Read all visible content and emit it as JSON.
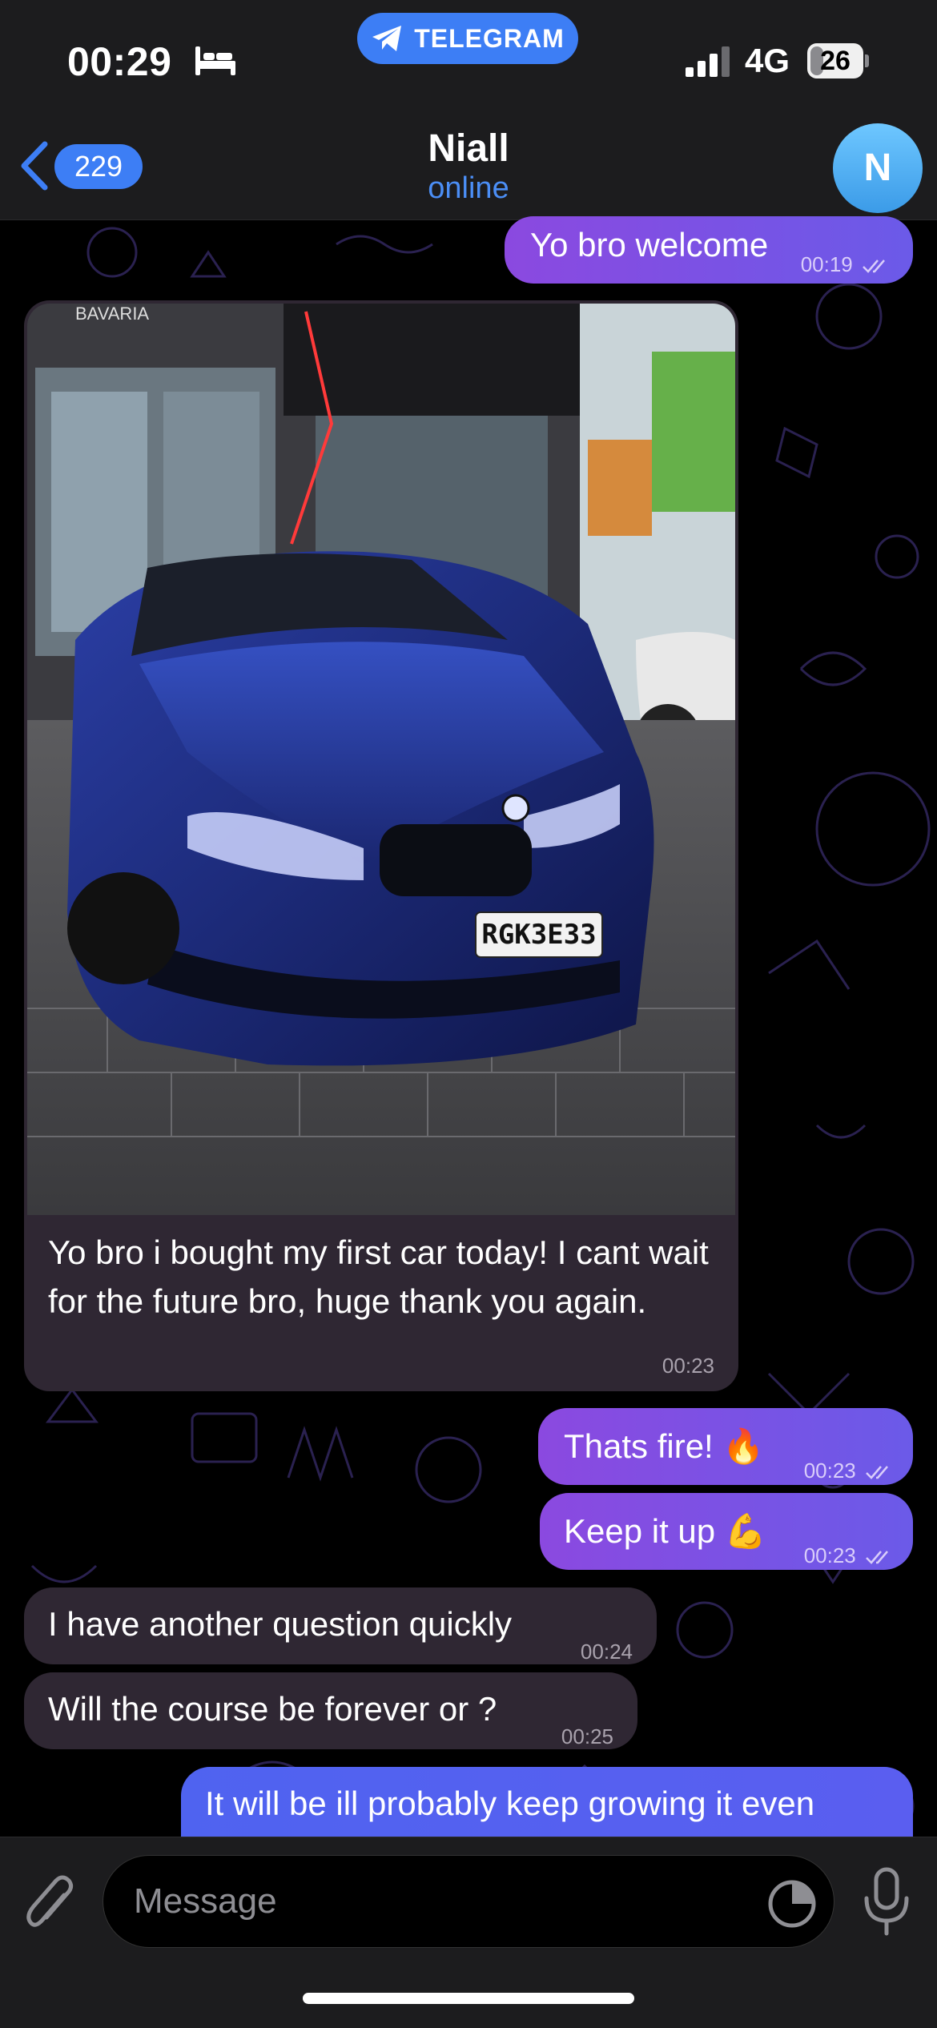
{
  "status_bar": {
    "time": "00:29",
    "app_pill": "TELEGRAM",
    "network": "4G",
    "battery": "26",
    "battery_level_percent": 26
  },
  "header": {
    "back_count": "229",
    "contact_name": "Niall",
    "contact_status": "online",
    "avatar_initial": "N"
  },
  "messages": [
    {
      "direction": "outgoing",
      "text": "Yo bro welcome",
      "time": "00:19",
      "read": true
    },
    {
      "direction": "incoming",
      "type": "photo",
      "text": "Yo bro i bought my first car today! I cant wait for the future bro, huge thank you again.",
      "time": "00:23",
      "photo_plate": "RGK3E33",
      "photo_sign": "BAVARIA"
    },
    {
      "direction": "outgoing",
      "text": "Thats fire! 🔥",
      "time": "00:23",
      "read": true
    },
    {
      "direction": "outgoing",
      "text": "Keep it up 💪",
      "time": "00:23",
      "read": true
    },
    {
      "direction": "incoming",
      "text": "I have another question quickly",
      "time": "00:24"
    },
    {
      "direction": "incoming",
      "text": "Will the course be forever or ?",
      "time": "00:25"
    },
    {
      "direction": "outgoing",
      "text": "It will be ill probably keep growing it even",
      "time": "",
      "partial": true
    }
  ],
  "input": {
    "placeholder": "Message"
  },
  "icons": {
    "back": "chevron-left-icon",
    "attach": "paperclip-icon",
    "sticker": "sticker-icon",
    "mic": "microphone-icon",
    "sleep": "bed-icon",
    "telegram": "telegram-plane-icon"
  },
  "colors": {
    "accent_blue": "#3d7ef5",
    "outgoing_bubble_start": "#8b49e0",
    "outgoing_bubble_end": "#6b5ae8",
    "incoming_bubble": "#2f2733",
    "status_online": "#4b8ef5",
    "background": "#000000"
  }
}
